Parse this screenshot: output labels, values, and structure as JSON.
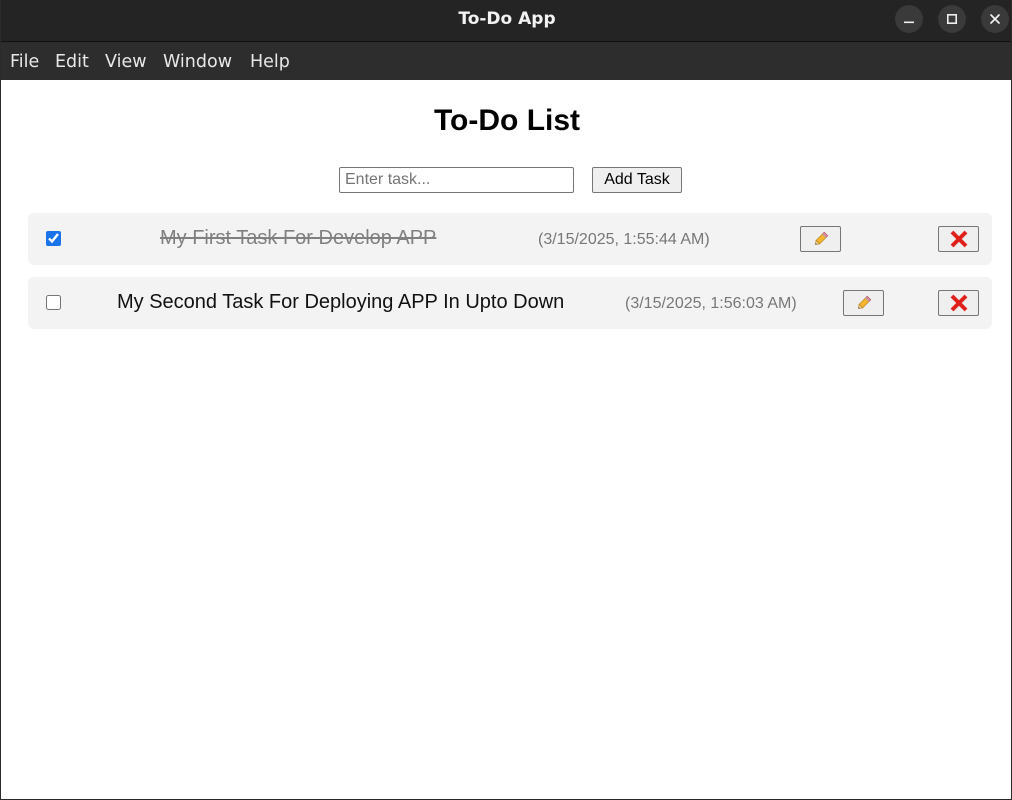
{
  "window": {
    "title": "To-Do App"
  },
  "menu": {
    "items": [
      "File",
      "Edit",
      "View",
      "Window",
      "Help"
    ]
  },
  "app": {
    "heading": "To-Do List",
    "input_placeholder": "Enter task...",
    "input_value": "",
    "add_button_label": "Add Task"
  },
  "tasks": [
    {
      "text": "My First Task For Develop APP",
      "timestamp": "(3/15/2025, 1:55:44 AM)",
      "completed": true,
      "edit_icon": "pencil-icon",
      "delete_icon": "cross-mark-icon"
    },
    {
      "text": "My Second Task For Deploying APP In Upto Down",
      "timestamp": "(3/15/2025, 1:56:03 AM)",
      "completed": false,
      "edit_icon": "pencil-icon",
      "delete_icon": "cross-mark-icon"
    }
  ],
  "colors": {
    "titlebar": "#242424",
    "menubar": "#2d2d2d",
    "row_background": "#f3f3f3",
    "delete_red": "#e0201b",
    "checkbox_accent": "#1a73e8"
  }
}
